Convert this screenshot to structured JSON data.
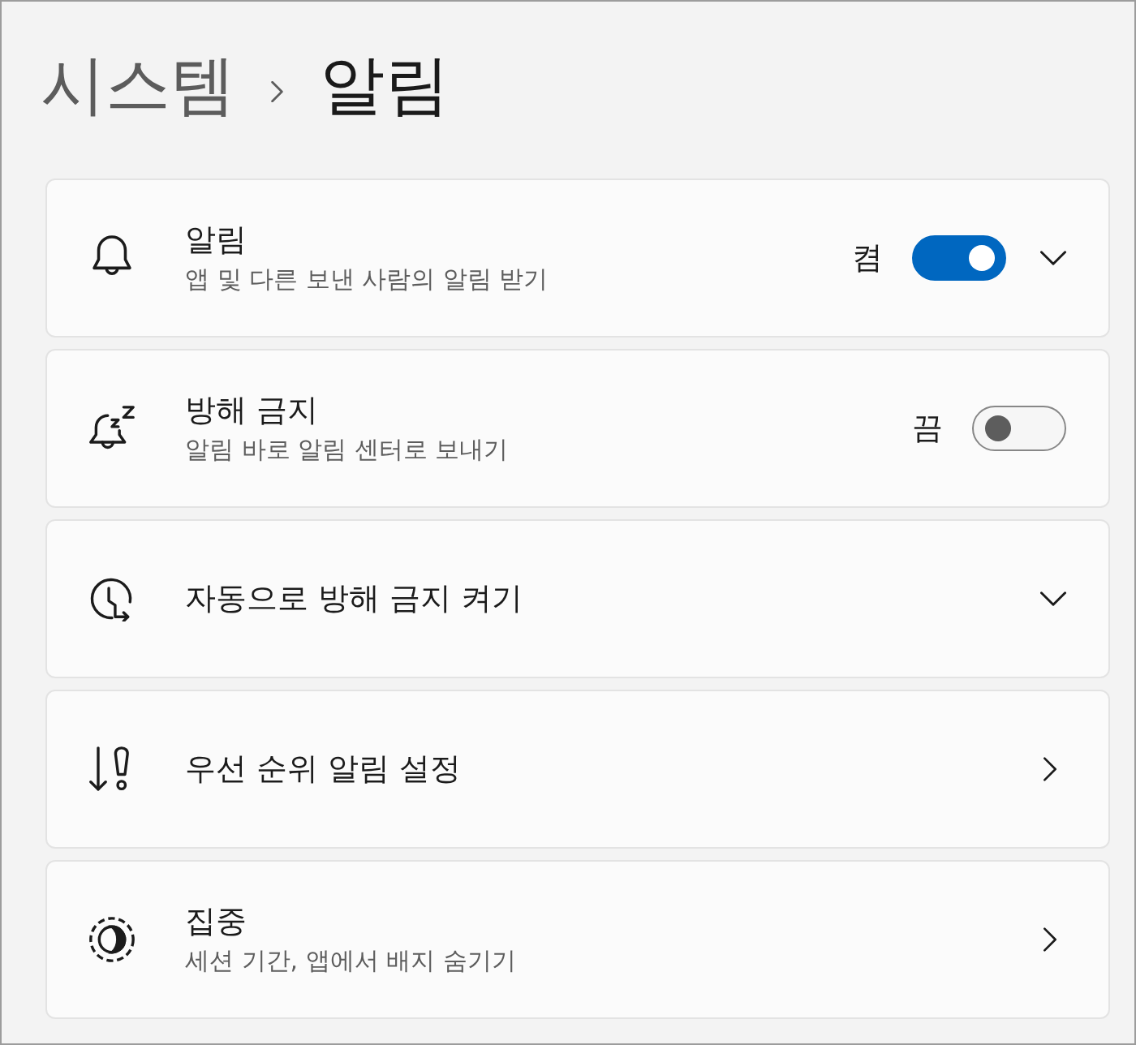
{
  "breadcrumb": {
    "parent": "시스템",
    "current": "알림"
  },
  "settings": [
    {
      "kind": "expander",
      "title": "알림",
      "description": "앱 및 다른 보낸 사람의 알림 받기",
      "toggle": {
        "label": "켬",
        "on": true
      }
    },
    {
      "kind": "toggle",
      "title": "방해 금지",
      "description": "알림 바로 알림 센터로 보내기",
      "toggle": {
        "label": "끔",
        "on": false
      }
    },
    {
      "kind": "expander",
      "title": "자동으로 방해 금지 켜기"
    },
    {
      "kind": "link",
      "title": "우선 순위 알림 설정"
    },
    {
      "kind": "link",
      "title": "집중",
      "description": "세션 기간, 앱에서 배지 숨기기"
    }
  ]
}
